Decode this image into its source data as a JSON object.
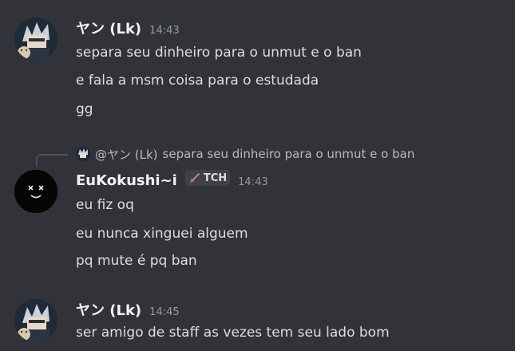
{
  "messages": [
    {
      "author": "ヤン (Lk)",
      "time": "14:43",
      "avatar_icon": "anime-avatar-icon",
      "lines": [
        "separa seu dinheiro para o unmut e o ban",
        "e fala a msm coisa para o estudada",
        "gg"
      ]
    },
    {
      "reply": {
        "author": "@ヤン (Lk)",
        "text": "separa seu dinheiro para o unmut e o ban"
      },
      "author": "EuKokushi~i",
      "tag": {
        "icon": "sword-icon",
        "label": "TCH"
      },
      "time": "14:43",
      "avatar_icon": "smiley-face-avatar-icon",
      "lines": [
        "eu fiz oq",
        "eu nunca xinguei alguem",
        "pq mute é pq ban"
      ]
    },
    {
      "author": "ヤン (Lk)",
      "time": "14:45",
      "avatar_icon": "anime-avatar-icon",
      "lines": [
        "ser amigo de staff as vezes tem seu lado bom"
      ]
    }
  ],
  "colors": {
    "background": "#313338",
    "username": "#f2f3f5",
    "text": "#dbdee1",
    "timestamp": "#949ba4"
  }
}
